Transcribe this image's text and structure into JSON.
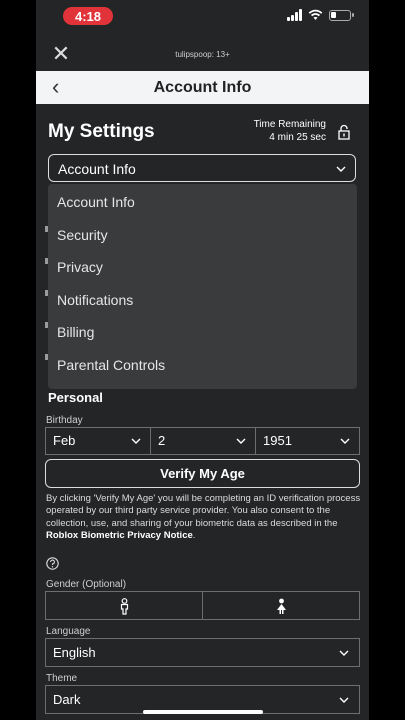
{
  "status_bar": {
    "time": "4:18"
  },
  "top_bar": {
    "username": "tulipspoop: 13+"
  },
  "header": {
    "title": "Account Info"
  },
  "settings": {
    "title": "My Settings",
    "time_remaining_label": "Time Remaining",
    "time_remaining_value": "4 min 25 sec",
    "dropdown_value": "Account Info",
    "menu_items": [
      "Account Info",
      "Security",
      "Privacy",
      "Notifications",
      "Billing",
      "Parental Controls"
    ]
  },
  "personal": {
    "heading": "Personal",
    "birthday_label": "Birthday",
    "birth_month": "Feb",
    "birth_day": "2",
    "birth_year": "1951",
    "verify_button": "Verify My Age",
    "notice_text": "By clicking 'Verify My Age' you will be completing an ID verification process operated by our third party service provider. You also consent to the collection, use, and sharing of your biometric data as described in the ",
    "notice_link": "Roblox Biometric Privacy Notice",
    "notice_end": ".",
    "gender_label": "Gender (Optional)",
    "language_label": "Language",
    "language_value": "English",
    "theme_label": "Theme",
    "theme_value": "Dark"
  },
  "icons": [
    "close-icon",
    "back-arrow-icon",
    "lock-icon",
    "chevron-down-icon",
    "help-icon",
    "male-icon",
    "female-icon"
  ]
}
